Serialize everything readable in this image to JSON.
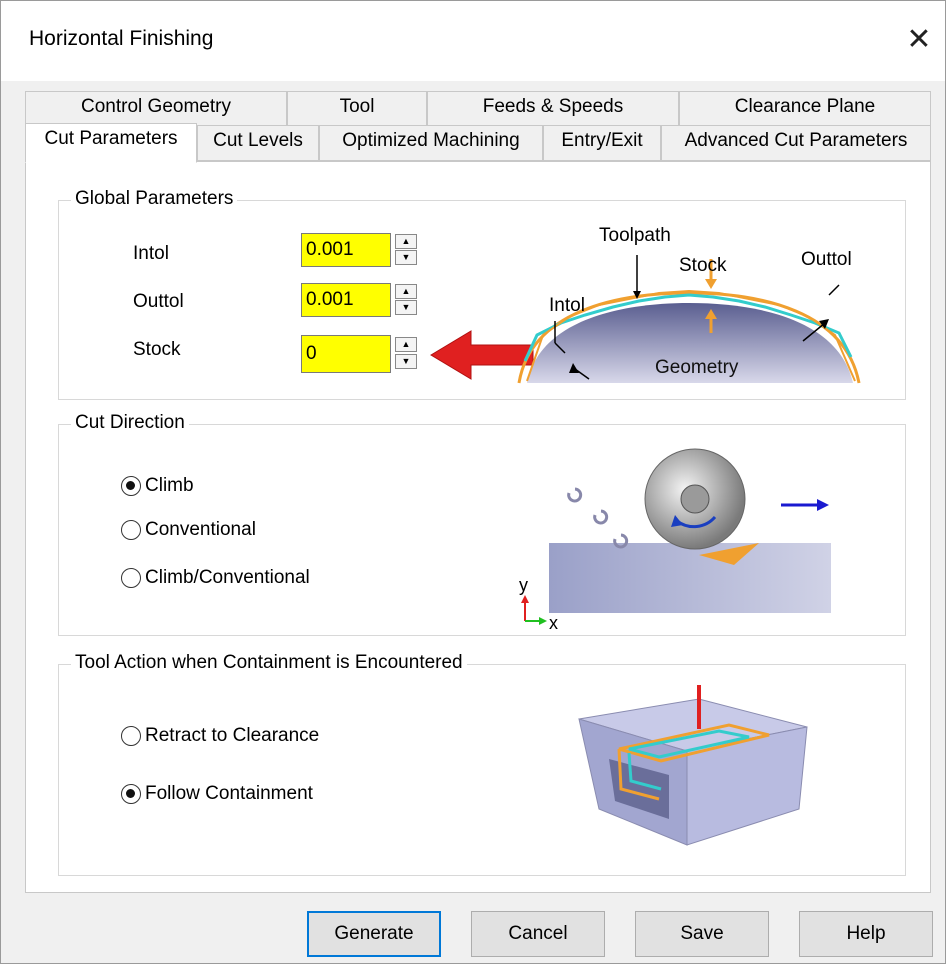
{
  "window": {
    "title": "Horizontal Finishing",
    "close_glyph": "✕"
  },
  "tabs": {
    "row1": [
      "Control Geometry",
      "Tool",
      "Feeds & Speeds",
      "Clearance Plane"
    ],
    "row2": [
      "Cut Parameters",
      "Cut Levels",
      "Optimized Machining",
      "Entry/Exit",
      "Advanced Cut Parameters"
    ],
    "active": "Cut Parameters"
  },
  "global_parameters": {
    "title": "Global Parameters",
    "intol": {
      "label": "Intol",
      "value": "0.001"
    },
    "outtol": {
      "label": "Outtol",
      "value": "0.001"
    },
    "stock": {
      "label": "Stock",
      "value": "0"
    },
    "diagram": {
      "toolpath": "Toolpath",
      "stock": "Stock",
      "outtol": "Outtol",
      "intol": "Intol",
      "geometry": "Geometry"
    }
  },
  "cut_direction": {
    "title": "Cut Direction",
    "options": [
      {
        "label": "Climb",
        "checked": true
      },
      {
        "label": "Conventional",
        "checked": false
      },
      {
        "label": "Climb/Conventional",
        "checked": false
      }
    ],
    "axis_y": "y",
    "axis_x": "x"
  },
  "tool_action": {
    "title": "Tool Action when Containment is Encountered",
    "options": [
      {
        "label": "Retract to Clearance",
        "checked": false
      },
      {
        "label": "Follow Containment",
        "checked": true
      }
    ]
  },
  "buttons": {
    "generate": "Generate",
    "cancel": "Cancel",
    "save": "Save",
    "help": "Help"
  },
  "colors": {
    "highlight_input": "#ffff00",
    "arrow": "#e02020",
    "accent_blue": "#0078d7",
    "toolpath": "#33cccc",
    "stock": "#f0a030"
  }
}
